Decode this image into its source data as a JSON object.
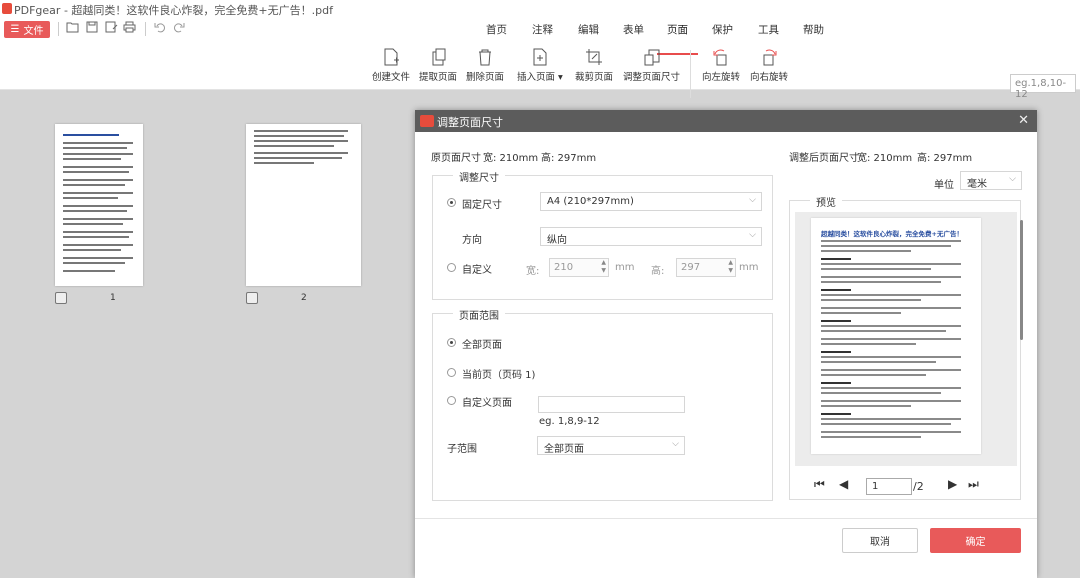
{
  "window": {
    "title": "PDFgear - 超越同类！这软件良心炸裂，完全免费+无广告！.pdf"
  },
  "file_button": {
    "label": "文件"
  },
  "menu": {
    "tabs": [
      "首页",
      "注释",
      "编辑",
      "表单",
      "页面",
      "保护",
      "工具",
      "帮助"
    ],
    "active": "页面"
  },
  "tools": [
    {
      "label": "创建文件",
      "icon": "create-file-icon"
    },
    {
      "label": "提取页面",
      "icon": "extract-pages-icon"
    },
    {
      "label": "删除页面",
      "icon": "delete-pages-icon"
    },
    {
      "label": "插入页面",
      "icon": "insert-page-icon"
    },
    {
      "label": "裁剪页面",
      "icon": "crop-page-icon"
    },
    {
      "label": "调整页面尺寸",
      "icon": "resize-page-icon"
    },
    {
      "label": "向左旋转",
      "icon": "rotate-left-icon"
    },
    {
      "label": "向右旋转",
      "icon": "rotate-right-icon"
    }
  ],
  "page_range_input": {
    "placeholder": "eg.1,8,10-12"
  },
  "thumbnails": [
    {
      "number": "1"
    },
    {
      "number": "2"
    }
  ],
  "dialog": {
    "title": "调整页面尺寸",
    "original_size_label": "原页面尺寸",
    "original_width": "宽:  210mm",
    "original_height": "高:  297mm",
    "adjusted_size_label": "调整后页面尺寸",
    "adjusted_width": "宽:  210mm",
    "adjusted_height": "高:  297mm",
    "unit_label": "单位",
    "unit_value": "毫米",
    "resize_group": {
      "legend": "调整尺寸",
      "fixed_size_label": "固定尺寸",
      "fixed_size_value": "A4 (210*297mm)",
      "orientation_label": "方向",
      "orientation_value": "纵向",
      "custom_label": "自定义",
      "width_label": "宽:",
      "width_value": "210",
      "height_label": "高:",
      "height_value": "297",
      "unit_mm": "mm"
    },
    "range_group": {
      "legend": "页面范围",
      "all_pages": "全部页面",
      "current_page": "当前页（页码 1)",
      "custom_pages": "自定义页面",
      "custom_hint": "eg. 1,8,9-12",
      "subrange_label": "子范围",
      "subrange_value": "全部页面"
    },
    "preview": {
      "legend": "预览",
      "page_title": "超越同类！这软件良心炸裂，完全免费+无广告！",
      "current_page": "1",
      "total_pages": "/2"
    },
    "cancel_label": "取消",
    "ok_label": "确定"
  },
  "colors": {
    "accent": "#e85a5a",
    "dialog_header": "#5c5c5c"
  }
}
